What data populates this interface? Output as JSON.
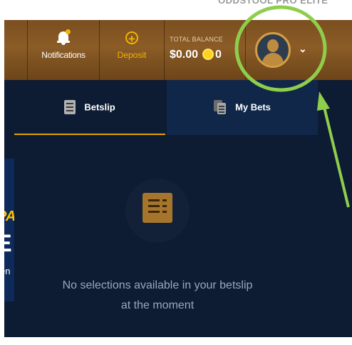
{
  "topbar": {
    "cut_text": "ODDSTOOL PRO ELITE"
  },
  "header": {
    "notifications_label": "Notifications",
    "deposit_label": "Deposit",
    "balance_caption": "TOTAL BALANCE",
    "balance_amount": "$0.00",
    "coins_amount": "0",
    "avatar_chevron": "⌄"
  },
  "tabs": [
    {
      "label": "Betslip",
      "active": true,
      "icon": "receipt-icon"
    },
    {
      "label": "My Bets",
      "active": false,
      "icon": "documents-icon"
    }
  ],
  "betslip": {
    "empty_icon": "receipt-icon",
    "empty_message": "No selections available in your betslip at the moment"
  },
  "promo_fragments": {
    "line1": "PA",
    "line2": "E",
    "line3": "en"
  },
  "colors": {
    "header_brown": "#8b5c26",
    "panel_navy": "#0d1b33",
    "accent_gold": "#e6a300",
    "annotation_green": "#8fce4c"
  }
}
